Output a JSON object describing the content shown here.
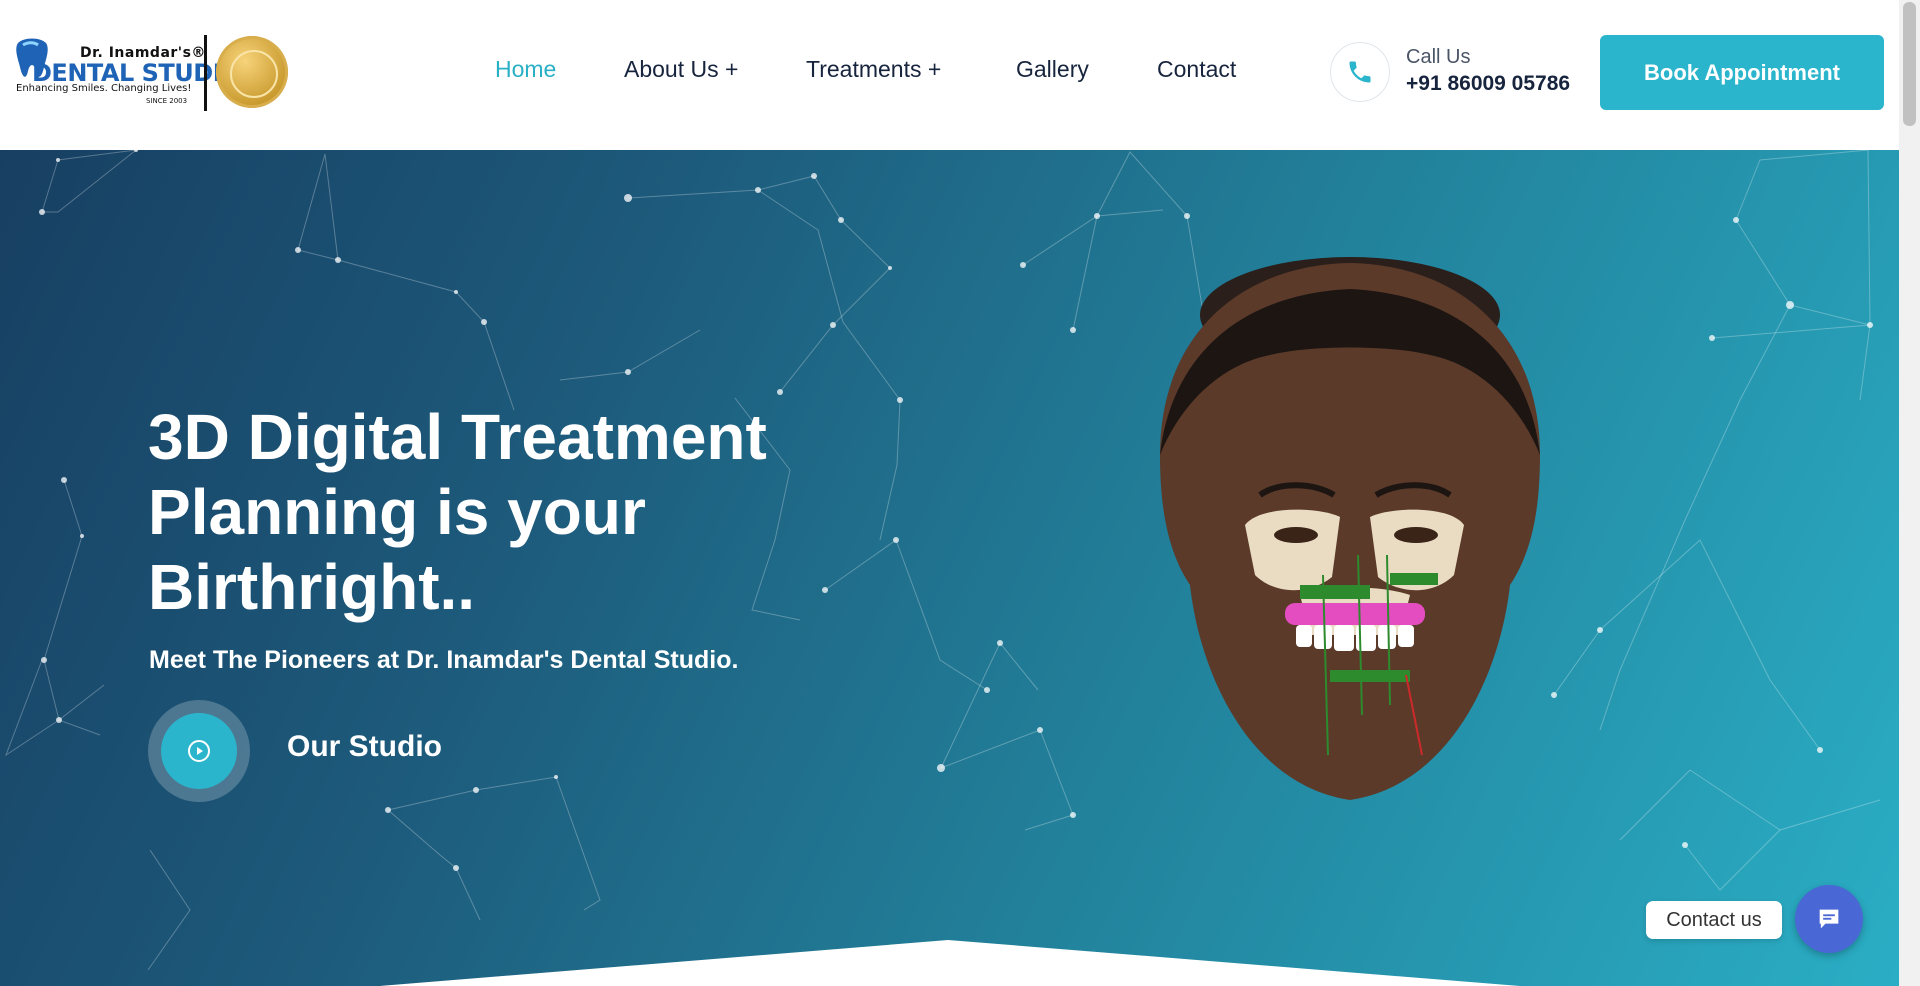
{
  "brand": {
    "top_line": "Dr. Inamdar's®",
    "name": "DENTAL STUDIO",
    "tagline": "Enhancing Smiles. Changing Lives!",
    "since": "SINCE 2003",
    "badge_icon": "award-seal-icon",
    "accent_color": "#2bb5cc",
    "brand_blue": "#1e63b5"
  },
  "nav": {
    "items": [
      {
        "label": "Home",
        "active": true
      },
      {
        "label": "About Us +",
        "active": false
      },
      {
        "label": "Treatments +",
        "active": false
      },
      {
        "label": "Gallery",
        "active": false
      },
      {
        "label": "Contact",
        "active": false
      }
    ]
  },
  "contact": {
    "icon": "phone-icon",
    "label": "Call Us",
    "number": "+91 86009 05786"
  },
  "cta": {
    "book_label": "Book Appointment"
  },
  "hero": {
    "title_lines": [
      "3D Digital Treatment",
      "Planning is your",
      "Birthright.."
    ],
    "subtitle": "Meet The Pioneers at Dr. Inamdar's Dental Studio.",
    "video_label": "Our Studio",
    "play_icon": "play-icon",
    "image": "3d-digital-treatment-planning-face"
  },
  "chat_widget": {
    "label": "Contact us",
    "icon": "chat-icon",
    "color": "#4a67d6"
  }
}
